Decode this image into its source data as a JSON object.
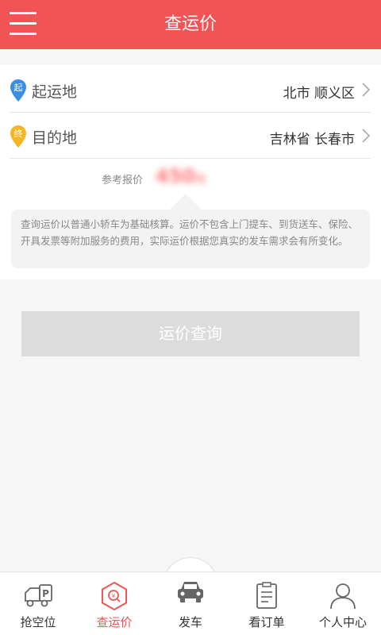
{
  "header": {
    "title": "查运价"
  },
  "form": {
    "origin": {
      "badge": "起",
      "label": "起运地",
      "value": "北市 顺义区"
    },
    "destination": {
      "badge": "终",
      "label": "目的地",
      "value": "吉林省 长春市"
    },
    "price": {
      "label": "参考报价",
      "value": "450",
      "unit": "元"
    },
    "note": "查询运价以普通小轿车为基础核算。运价不包含上门提车、到货送车、保险、开具发票等附加服务的费用，实际运价根据您真实的发车需求会有所变化。"
  },
  "query_button": {
    "label": "运价查询"
  },
  "tabs": [
    {
      "label": "抢空位",
      "icon": "truck-parking-icon"
    },
    {
      "label": "查运价",
      "icon": "price-search-icon",
      "active": true
    },
    {
      "label": "发车",
      "icon": "car-icon"
    },
    {
      "label": "看订单",
      "icon": "order-list-icon"
    },
    {
      "label": "个人中心",
      "icon": "user-icon"
    }
  ],
  "colors": {
    "brand": "#f25354",
    "origin_pin": "#3a8ee6",
    "destination_pin": "#f5b622",
    "button_disabled": "#dcdcdc"
  }
}
